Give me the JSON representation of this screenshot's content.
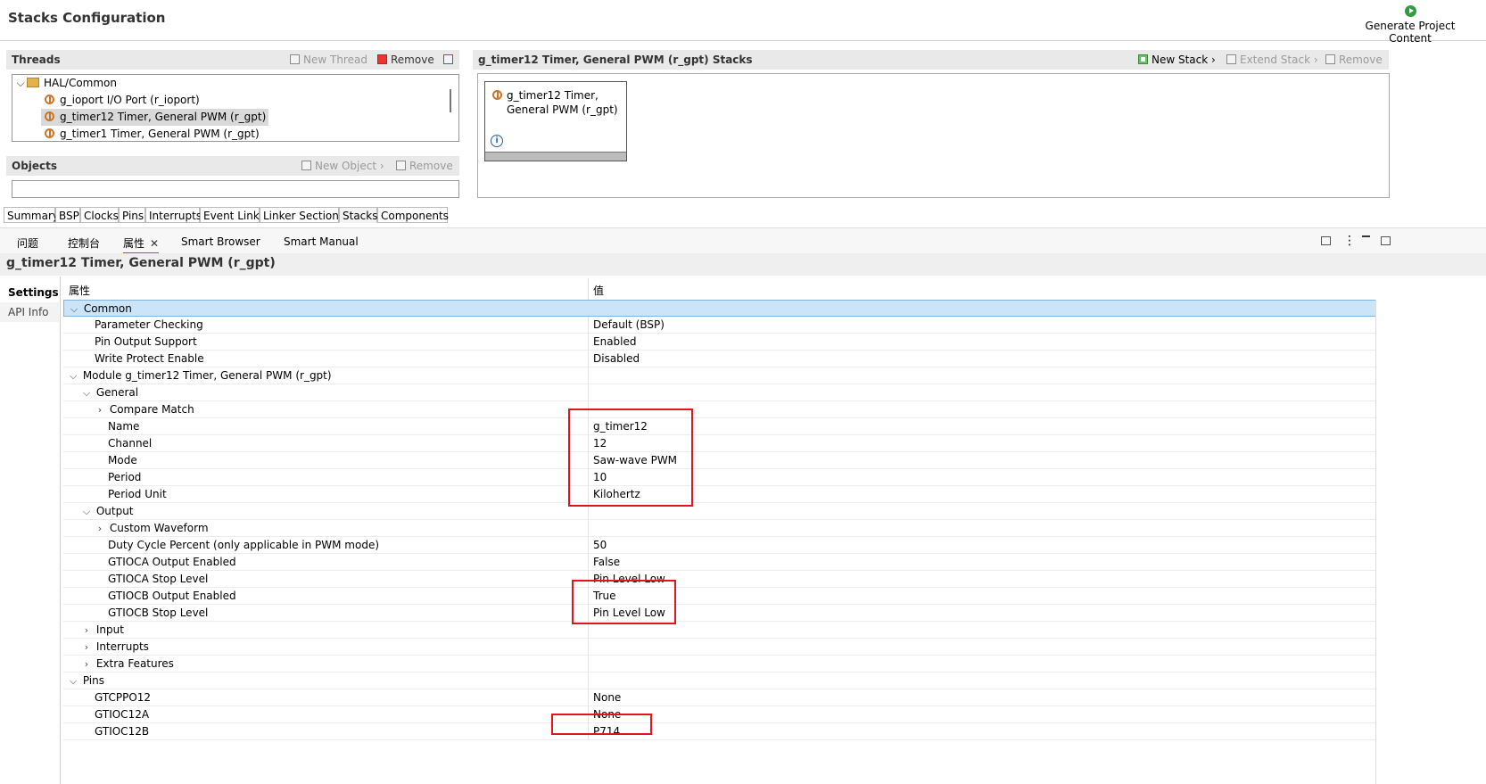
{
  "header": {
    "title": "Stacks Configuration",
    "generate_label": "Generate Project Content"
  },
  "threads": {
    "title": "Threads",
    "new_thread": "New Thread",
    "remove": "Remove",
    "tree": [
      {
        "label": "HAL/Common"
      },
      {
        "label": "g_ioport I/O Port (r_ioport)"
      },
      {
        "label": "g_timer12 Timer, General PWM (r_gpt)"
      },
      {
        "label": "g_timer1 Timer, General PWM (r_gpt)"
      }
    ]
  },
  "objects": {
    "title": "Objects",
    "new_object": "New Object",
    "remove": "Remove"
  },
  "stacks": {
    "title": "g_timer12 Timer, General PWM (r_gpt) Stacks",
    "new_stack": "New Stack",
    "extend_stack": "Extend Stack",
    "remove": "Remove",
    "card_line1": "g_timer12 Timer,",
    "card_line2": "General PWM (r_gpt)"
  },
  "config_tabs": [
    "Summary",
    "BSP",
    "Clocks",
    "Pins",
    "Interrupts",
    "Event Links",
    "Linker Sections",
    "Stacks",
    "Components"
  ],
  "view_tabs": [
    "问题",
    "控制台",
    "属性",
    "Smart Browser",
    "Smart Manual"
  ],
  "properties": {
    "title": "g_timer12 Timer, General PWM (r_gpt)",
    "side_tabs": [
      "Settings",
      "API Info"
    ],
    "col_property": "属性",
    "col_value": "值",
    "rows": [
      {
        "k": "Common",
        "v": ""
      },
      {
        "k": "Parameter Checking",
        "v": "Default (BSP)"
      },
      {
        "k": "Pin Output Support",
        "v": "Enabled"
      },
      {
        "k": "Write Protect Enable",
        "v": "Disabled"
      },
      {
        "k": "Module g_timer12 Timer, General PWM (r_gpt)",
        "v": ""
      },
      {
        "k": "General",
        "v": ""
      },
      {
        "k": "Compare Match",
        "v": ""
      },
      {
        "k": "Name",
        "v": "g_timer12"
      },
      {
        "k": "Channel",
        "v": "12"
      },
      {
        "k": "Mode",
        "v": "Saw-wave PWM"
      },
      {
        "k": "Period",
        "v": "10"
      },
      {
        "k": "Period Unit",
        "v": "Kilohertz"
      },
      {
        "k": "Output",
        "v": ""
      },
      {
        "k": "Custom Waveform",
        "v": ""
      },
      {
        "k": "Duty Cycle Percent (only applicable in PWM mode)",
        "v": "50"
      },
      {
        "k": "GTIOCA Output Enabled",
        "v": "False"
      },
      {
        "k": "GTIOCA Stop Level",
        "v": "Pin Level Low"
      },
      {
        "k": "GTIOCB Output Enabled",
        "v": "True"
      },
      {
        "k": "GTIOCB Stop Level",
        "v": "Pin Level Low"
      },
      {
        "k": "Input",
        "v": ""
      },
      {
        "k": "Interrupts",
        "v": ""
      },
      {
        "k": "Extra Features",
        "v": ""
      },
      {
        "k": "Pins",
        "v": ""
      },
      {
        "k": "GTCPPO12",
        "v": "None"
      },
      {
        "k": "GTIOC12A",
        "v": "None"
      },
      {
        "k": "GTIOC12B",
        "v": "P714"
      }
    ]
  }
}
